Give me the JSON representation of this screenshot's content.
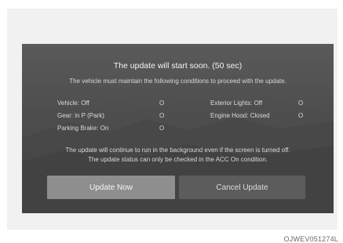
{
  "dialog": {
    "title": "The update will start soon. (50 sec)",
    "subtitle": "The vehicle must maintain the following conditions to proceed with the update.",
    "conditions_left": [
      {
        "label": "Vehicle: Off",
        "status": "O"
      },
      {
        "label": "Gear: in P (Park)",
        "status": "O"
      },
      {
        "label": "Parking Brake: On",
        "status": "O"
      }
    ],
    "conditions_right": [
      {
        "label": "Exterior Lights: Off",
        "status": "O"
      },
      {
        "label": "Engine Hood: Closed",
        "status": "O"
      }
    ],
    "footer_line1": "The update will continue to run in the background even if the screen is turned off.",
    "footer_line2": "The update status can only be checked in the ACC On condition.",
    "update_button_label": "Update Now",
    "cancel_button_label": "Cancel Update"
  },
  "figure_code": "OJWEV051274L"
}
